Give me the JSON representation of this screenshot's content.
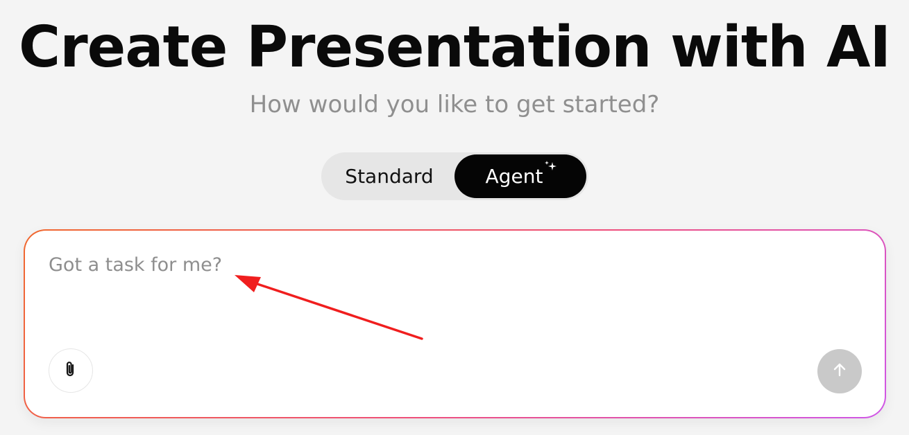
{
  "header": {
    "title": "Create Presentation with AI",
    "subtitle": "How would you like to get started?"
  },
  "mode_toggle": {
    "options": [
      {
        "label": "Standard",
        "selected": false
      },
      {
        "label": "Agent",
        "selected": true,
        "icon": "sparkle-icon"
      }
    ]
  },
  "prompt": {
    "placeholder": "Got a task for me?",
    "value": "",
    "attach_icon": "paperclip-icon",
    "send_icon": "arrow-up-icon"
  },
  "annotation": {
    "type": "arrow",
    "color": "#f01e1e"
  },
  "colors": {
    "accent_gradient_start": "#f0682e",
    "accent_gradient_mid": "#ef4f7a",
    "accent_gradient_end": "#cf56e8",
    "selected_mode_bg": "#050505",
    "send_disabled": "#c9c9c9"
  }
}
